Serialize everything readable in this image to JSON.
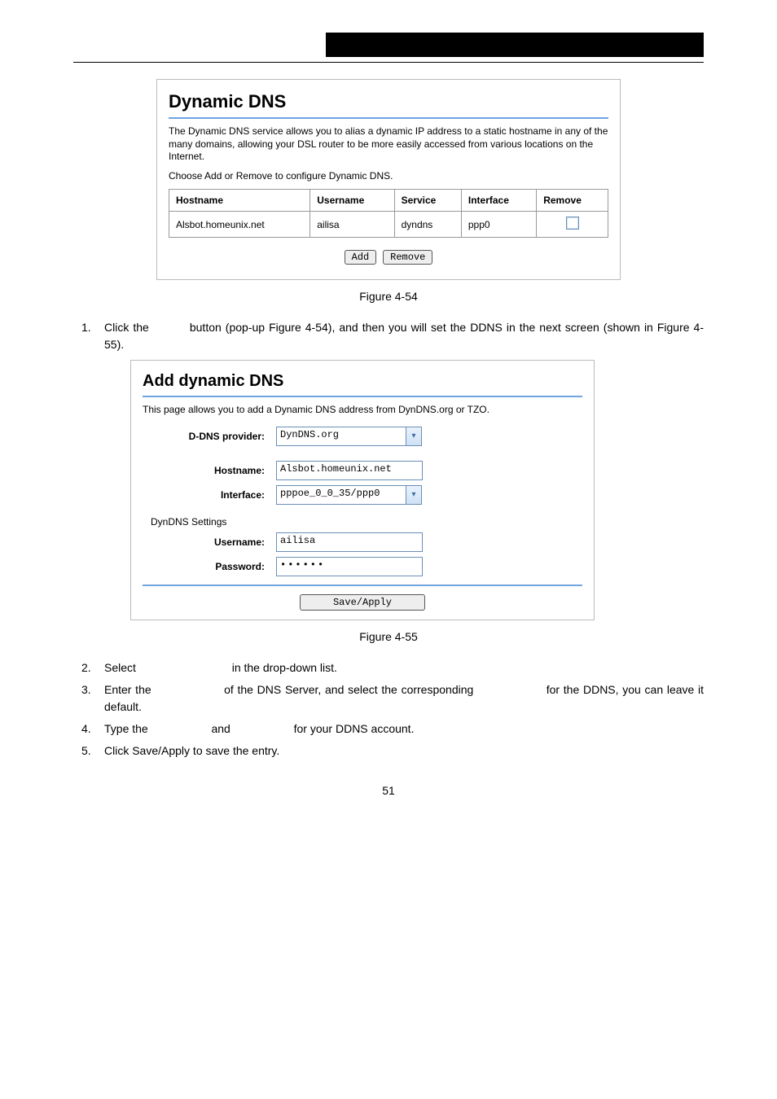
{
  "header": {
    "blackbar": ""
  },
  "panel1": {
    "title": "Dynamic DNS",
    "desc1": "The Dynamic DNS service allows you to alias a dynamic IP address to a static hostname in any of the many domains, allowing your DSL router to be more easily accessed from various locations on the Internet.",
    "desc2": "Choose Add or Remove to configure Dynamic DNS.",
    "cols": {
      "hostname": "Hostname",
      "username": "Username",
      "service": "Service",
      "interface": "Interface",
      "remove": "Remove"
    },
    "row": {
      "hostname": "Alsbot.homeunix.net",
      "username": "ailisa",
      "service": "dyndns",
      "interface": "ppp0"
    },
    "btn_add": "Add",
    "btn_remove": "Remove",
    "figcap": "Figure 4-54"
  },
  "step1": {
    "idx": "1.",
    "a": "Click the ",
    "b": " button (pop-up Figure 4-54), and then you will set the DDNS in the next screen (shown in Figure 4-55)."
  },
  "panel2": {
    "title": "Add dynamic DNS",
    "desc": "This page allows you to add a Dynamic DNS address from DynDNS.org or TZO.",
    "lbl_provider": "D-DNS provider:",
    "val_provider": "DynDNS.org",
    "lbl_hostname": "Hostname:",
    "val_hostname": "Alsbot.homeunix.net",
    "lbl_interface": "Interface:",
    "val_interface": "pppoe_0_0_35/ppp0",
    "section": "DynDNS Settings",
    "lbl_username": "Username:",
    "val_username": "ailisa",
    "lbl_password": "Password:",
    "val_password": "••••••",
    "btn_save": "Save/Apply",
    "figcap": "Figure 4-55"
  },
  "steps_rest": {
    "s2": {
      "idx": "2.",
      "a": "Select ",
      "b": " in the drop-down list."
    },
    "s3": {
      "idx": "3.",
      "a": "Enter  the ",
      "b": " of  the  DNS  Server,  and  select  the  corresponding ",
      "c": " for  the DDNS, you can leave it default."
    },
    "s4": {
      "idx": "4.",
      "a": "Type the ",
      "b": " and ",
      "c": " for your DDNS account."
    },
    "s5": {
      "idx": "5.",
      "a": "Click Save/Apply to save the entry."
    }
  },
  "pagenum": "51"
}
